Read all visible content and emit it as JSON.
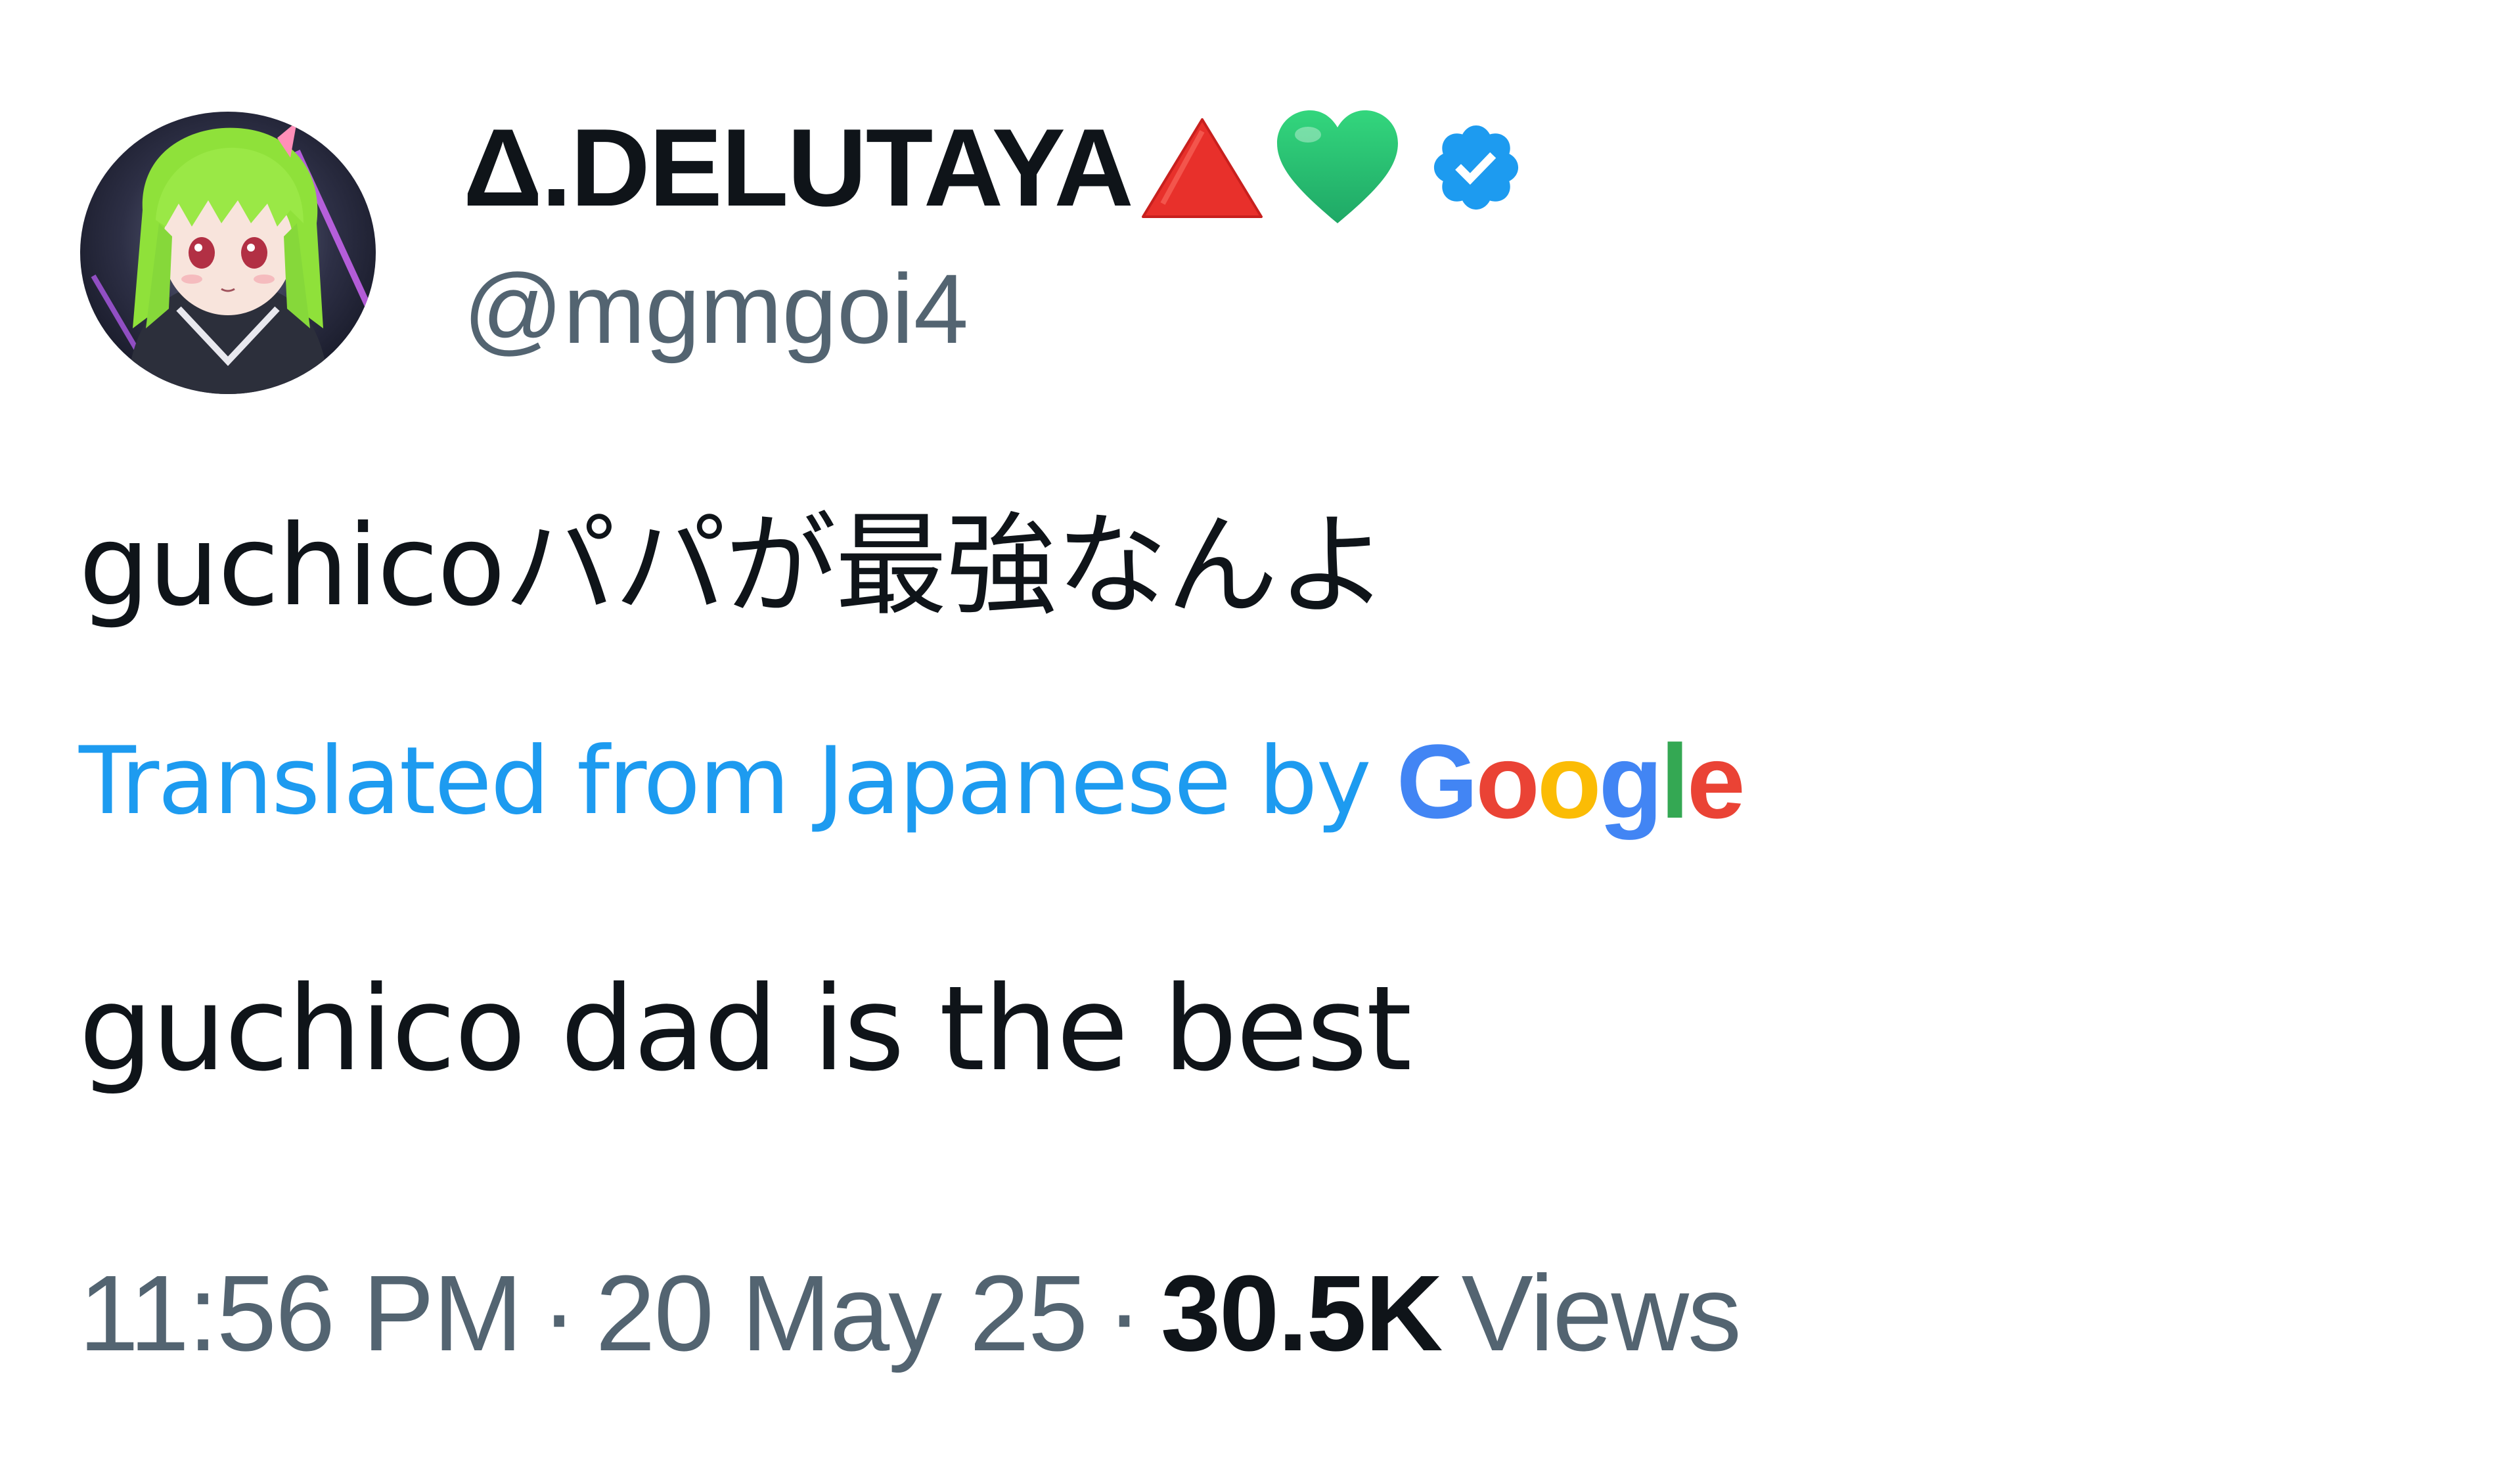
{
  "author": {
    "display_name": "Δ.DELUTAYA",
    "handle": "@mgmgoi4",
    "display_name_emoji": [
      "red-triangle-icon",
      "green-heart-icon"
    ],
    "verified_badge": "verified-badge-icon",
    "verified_color": "#1d9bf0"
  },
  "tweet": {
    "text": "guchicoパパが最強なんよ",
    "translate_label": "Translated from Japanese by",
    "translate_provider": "Google",
    "translated_text": "guchico dad is the best"
  },
  "meta": {
    "time": "11:56 PM",
    "separator": "·",
    "date": "20 May 25",
    "views_count": "30.5K",
    "views_label": "Views"
  },
  "colors": {
    "text_primary": "#0f1419",
    "text_secondary": "#536471",
    "link": "#1d9bf0",
    "google_blue": "#4285F4",
    "google_red": "#EA4335",
    "google_yellow": "#FBBC05",
    "google_green": "#34A853"
  }
}
